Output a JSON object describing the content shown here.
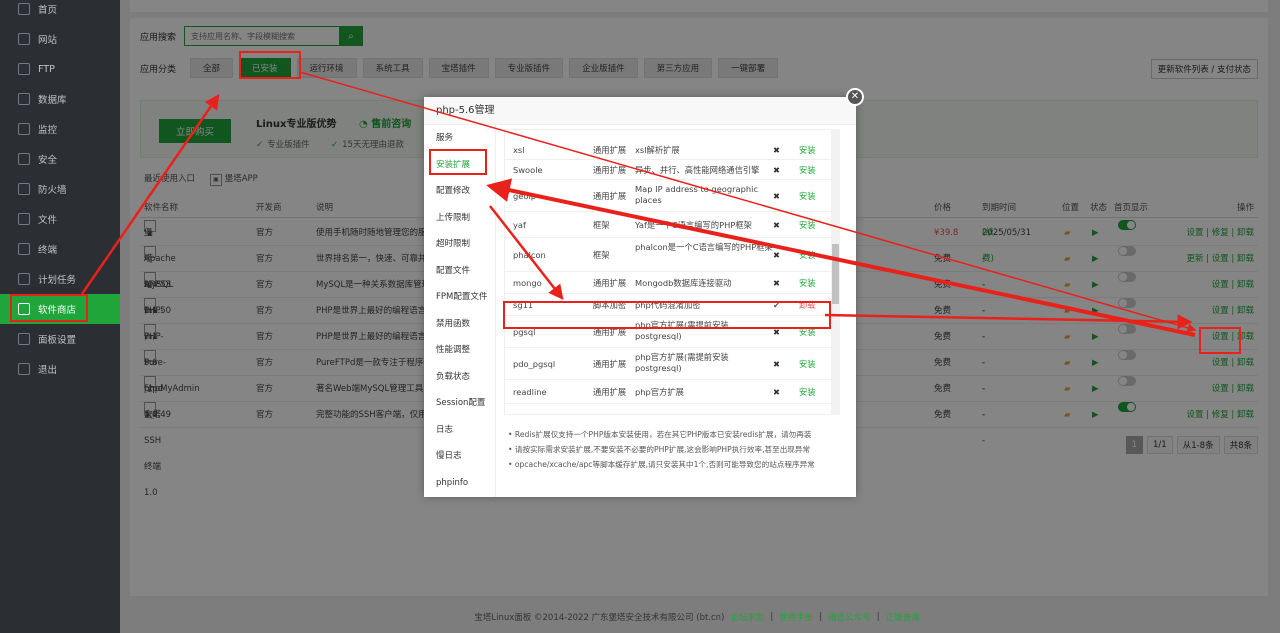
{
  "sidebar": {
    "items": [
      {
        "label": "首页",
        "icon": "home-icon"
      },
      {
        "label": "网站",
        "icon": "globe-icon"
      },
      {
        "label": "FTP",
        "icon": "ftp-icon"
      },
      {
        "label": "数据库",
        "icon": "database-icon"
      },
      {
        "label": "监控",
        "icon": "monitor-icon"
      },
      {
        "label": "安全",
        "icon": "shield-icon"
      },
      {
        "label": "防火墙",
        "icon": "firewall-icon"
      },
      {
        "label": "文件",
        "icon": "folder-icon"
      },
      {
        "label": "终端",
        "icon": "terminal-icon"
      },
      {
        "label": "计划任务",
        "icon": "schedule-icon"
      },
      {
        "label": "软件商店",
        "icon": "store-icon",
        "active": true
      },
      {
        "label": "面板设置",
        "icon": "gear-icon"
      },
      {
        "label": "退出",
        "icon": "logout-icon"
      }
    ]
  },
  "search": {
    "label": "应用搜索",
    "placeholder": "支持应用名称、字段模糊搜索",
    "button_icon": "search-icon"
  },
  "category": {
    "label": "应用分类",
    "items": [
      "全部",
      "已安装",
      "运行环境",
      "系统工具",
      "宝塔插件",
      "专业版插件",
      "企业版插件",
      "第三方应用",
      "一键部署"
    ],
    "selected": "已安装"
  },
  "update_button": "更新软件列表 / 支付状态",
  "promo": {
    "buy": "立即购买",
    "title": "Linux专业版优势",
    "consult": "售前咨询",
    "features": [
      "专业版插件",
      "15天无理由退款"
    ]
  },
  "quick": {
    "entry": "最近使用入口",
    "app": "堡塔APP"
  },
  "table": {
    "headers": [
      "软件名称",
      "开发商",
      "说明",
      "价格",
      "到期时间",
      "位置",
      "状态",
      "首页显示",
      "操作"
    ],
    "rows": [
      {
        "name": "堡塔APP 1.1",
        "dev": "官方",
        "desc": "使用手机随时随地管理您的服务器",
        "price": "¥39.8",
        "expire": "2025/05/31",
        "renew": "(续费)",
        "on": true,
        "ops": "设置 | 修复 | 卸载"
      },
      {
        "name": "Apache 2.4.53",
        "dev": "官方",
        "desc": "世界排名第一，快速、可靠并且可",
        "price": "免费",
        "expire": "--",
        "renew": "",
        "on": false,
        "ops": "更新 | 设置 | 卸载"
      },
      {
        "name": "MySQL 5.6.50",
        "dev": "官方",
        "desc": "MySQL是一种关系数据库管理系统",
        "price": "免费",
        "expire": "--",
        "renew": "",
        "on": false,
        "ops": "设置 | 卸载"
      },
      {
        "name": "PHP-7.1",
        "dev": "官方",
        "desc": "PHP是世界上最好的编程语言",
        "price": "免费",
        "expire": "--",
        "renew": "",
        "on": false,
        "ops": "设置 | 卸载"
      },
      {
        "name": "PHP-5.6",
        "dev": "官方",
        "desc": "PHP是世界上最好的编程语言",
        "price": "免费",
        "expire": "--",
        "renew": "",
        "on": false,
        "ops": "设置 | 卸载"
      },
      {
        "name": "Pure-Ftpd 1.0.49",
        "dev": "官方",
        "desc": "PureFTPd是一款专注于程序健壮",
        "price": "免费",
        "expire": "--",
        "renew": "",
        "on": false,
        "ops": "设置 | 卸载"
      },
      {
        "name": "phpMyAdmin 4.4",
        "dev": "官方",
        "desc": "著名Web端MySQL管理工具",
        "price": "免费",
        "expire": "--",
        "renew": "",
        "on": false,
        "ops": "设置 | 卸载"
      },
      {
        "name": "宝塔SSH终端 1.0",
        "dev": "官方",
        "desc": "完整功能的SSH客户端，仅用于",
        "price": "免费",
        "expire": "--",
        "renew": "",
        "on": true,
        "ops": "设置 | 修复 | 卸载"
      }
    ]
  },
  "pager": {
    "current": "1",
    "pages": "1/1",
    "range": "从1-8条",
    "total": "共8条"
  },
  "footer": {
    "copyright": "宝塔Linux面板 ©2014-2022 广东堡塔安全技术有限公司 (bt.cn)",
    "links": [
      "论坛求助",
      "使用手册",
      "微信公众号",
      "正版查询"
    ]
  },
  "modal": {
    "title": "php-5.6管理",
    "nav": [
      "服务",
      "安装扩展",
      "配置修改",
      "上传限制",
      "超时限制",
      "配置文件",
      "FPM配置文件",
      "禁用函数",
      "性能调整",
      "负载状态",
      "Session配置",
      "日志",
      "慢日志",
      "phpinfo"
    ],
    "active_nav": "安装扩展",
    "extensions": [
      {
        "name": "xsl",
        "type": "通用扩展",
        "desc": "xsl解析扩展",
        "installed": false,
        "action": "安装"
      },
      {
        "name": "Swoole",
        "type": "通用扩展",
        "desc": "异步、并行、高性能网络通信引擎",
        "installed": false,
        "action": "安装"
      },
      {
        "name": "geoip",
        "type": "通用扩展",
        "desc": "Map IP address to geographic places",
        "installed": false,
        "action": "安装"
      },
      {
        "name": "yaf",
        "type": "框架",
        "desc": "Yaf是一个C语言编写的PHP框架",
        "installed": false,
        "action": "安装"
      },
      {
        "name": "phalcon",
        "type": "框架",
        "desc": "phalcon是一个C语言编写的PHP框架",
        "installed": false,
        "action": "安装"
      },
      {
        "name": "mongo",
        "type": "通用扩展",
        "desc": "Mongodb数据库连接驱动",
        "installed": false,
        "action": "安装"
      },
      {
        "name": "sg11",
        "type": "脚本加密",
        "desc": "php代码混淆加密",
        "installed": true,
        "action": "卸载"
      },
      {
        "name": "pgsql",
        "type": "通用扩展",
        "desc": "php官方扩展(需提前安装postgresql)",
        "installed": false,
        "action": "安装"
      },
      {
        "name": "pdo_pgsql",
        "type": "通用扩展",
        "desc": "php官方扩展(需提前安装postgresql)",
        "installed": false,
        "action": "安装"
      },
      {
        "name": "readline",
        "type": "通用扩展",
        "desc": "php官方扩展",
        "installed": false,
        "action": "安装"
      }
    ],
    "notes": [
      "Redis扩展仅支持一个PHP版本安装使用，若在其它PHP版本已安装redis扩展，请勿再装",
      "请按实际需求安装扩展,不要安装不必要的PHP扩展,这会影响PHP执行效率,甚至出现异常",
      "opcache/xcache/apc等脚本缓存扩展,请只安装其中1个,否则可能导致您的站点程序异常"
    ]
  },
  "colors": {
    "accent": "#20a53a",
    "annotation": "#e8221b",
    "sidebar": "#2b2f33"
  }
}
